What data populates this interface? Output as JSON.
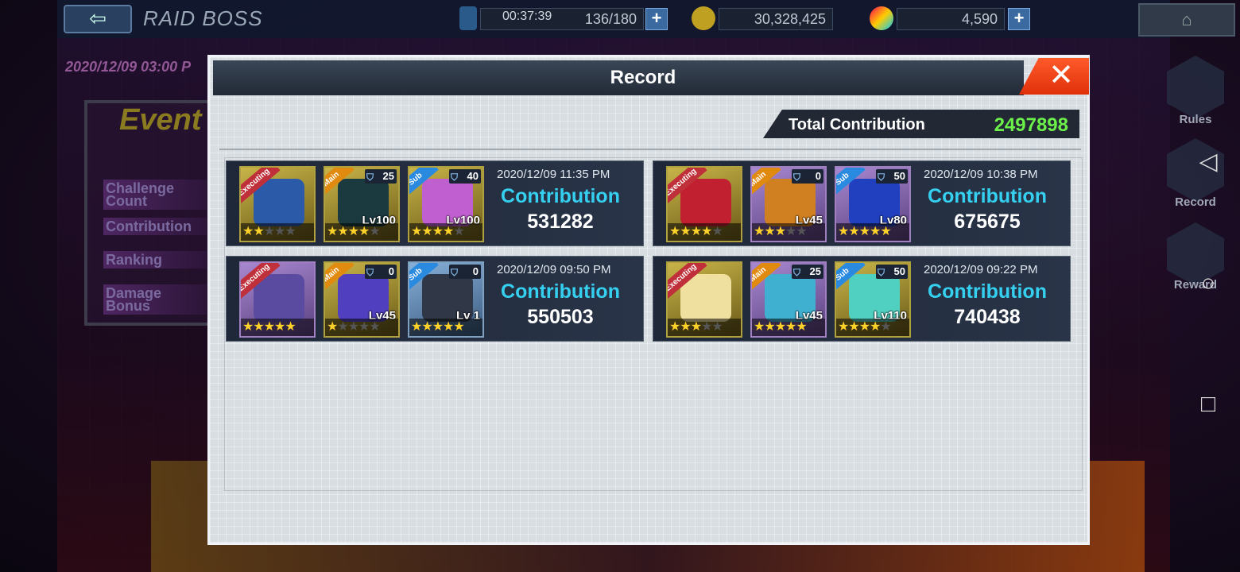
{
  "header": {
    "title": "RAID BOSS",
    "timer": "00:37:39",
    "energy": "136/180",
    "zenny": "30,328,425",
    "crystals": "4,590"
  },
  "background": {
    "date": "2020/12/09 03:00 P",
    "event_label": "Event",
    "left_items": [
      "Challenge Count",
      "Contribution",
      "Ranking",
      "Damage Bonus"
    ],
    "side_buttons": [
      "Rules",
      "Record",
      "Reward"
    ]
  },
  "modal": {
    "title": "Record",
    "close_symbol": "✕",
    "total_label": "Total Contribution",
    "total_value": "2497898",
    "records": [
      {
        "time": "2020/12/09 11:35 PM",
        "label": "Contribution",
        "value": "531282",
        "slots": [
          {
            "tag": "Executing",
            "stars": 2,
            "color": "gold",
            "icon": "hero-x-icon"
          },
          {
            "tag": "Main",
            "badge": "25",
            "level": "Lv100",
            "stars": 4,
            "color": "gold",
            "icon": "buster-cannon-icon"
          },
          {
            "tag": "Sub",
            "badge": "40",
            "level": "Lv100",
            "stars": 4,
            "color": "gold",
            "icon": "rocket-launcher-icon"
          }
        ]
      },
      {
        "time": "2020/12/09 10:38 PM",
        "label": "Contribution",
        "value": "675675",
        "slots": [
          {
            "tag": "Executing",
            "stars": 4,
            "color": "gold",
            "icon": "hero-red-icon"
          },
          {
            "tag": "Main",
            "badge": "0",
            "level": "Lv45",
            "stars": 3,
            "color": "purple",
            "icon": "drill-gun-icon"
          },
          {
            "tag": "Sub",
            "badge": "50",
            "level": "Lv80",
            "stars": 5,
            "color": "purple",
            "icon": "arm-cannon-icon"
          }
        ]
      },
      {
        "time": "2020/12/09 09:50 PM",
        "label": "Contribution",
        "value": "550503",
        "slots": [
          {
            "tag": "Executing",
            "stars": 5,
            "color": "purple",
            "icon": "hero-helmet-icon"
          },
          {
            "tag": "Main",
            "badge": "0",
            "level": "Lv45",
            "stars": 1,
            "color": "gold",
            "icon": "blaster-icon"
          },
          {
            "tag": "Sub",
            "badge": "0",
            "level": "Lv 1",
            "stars": 5,
            "color": "blue",
            "icon": "bazooka-icon"
          }
        ]
      },
      {
        "time": "2020/12/09 09:22 PM",
        "label": "Contribution",
        "value": "740438",
        "slots": [
          {
            "tag": "Executing",
            "stars": 3,
            "color": "gold",
            "icon": "hero-girl-icon"
          },
          {
            "tag": "Main",
            "badge": "25",
            "level": "Lv45",
            "stars": 5,
            "color": "purple",
            "icon": "rail-gun-icon"
          },
          {
            "tag": "Sub",
            "badge": "50",
            "level": "Lv110",
            "stars": 4,
            "color": "gold",
            "icon": "pulse-cannon-icon"
          }
        ]
      }
    ]
  },
  "colors": {
    "accent_cyan": "#35d0f0",
    "total_green": "#6cf04a",
    "close_red": "#e8401a"
  }
}
